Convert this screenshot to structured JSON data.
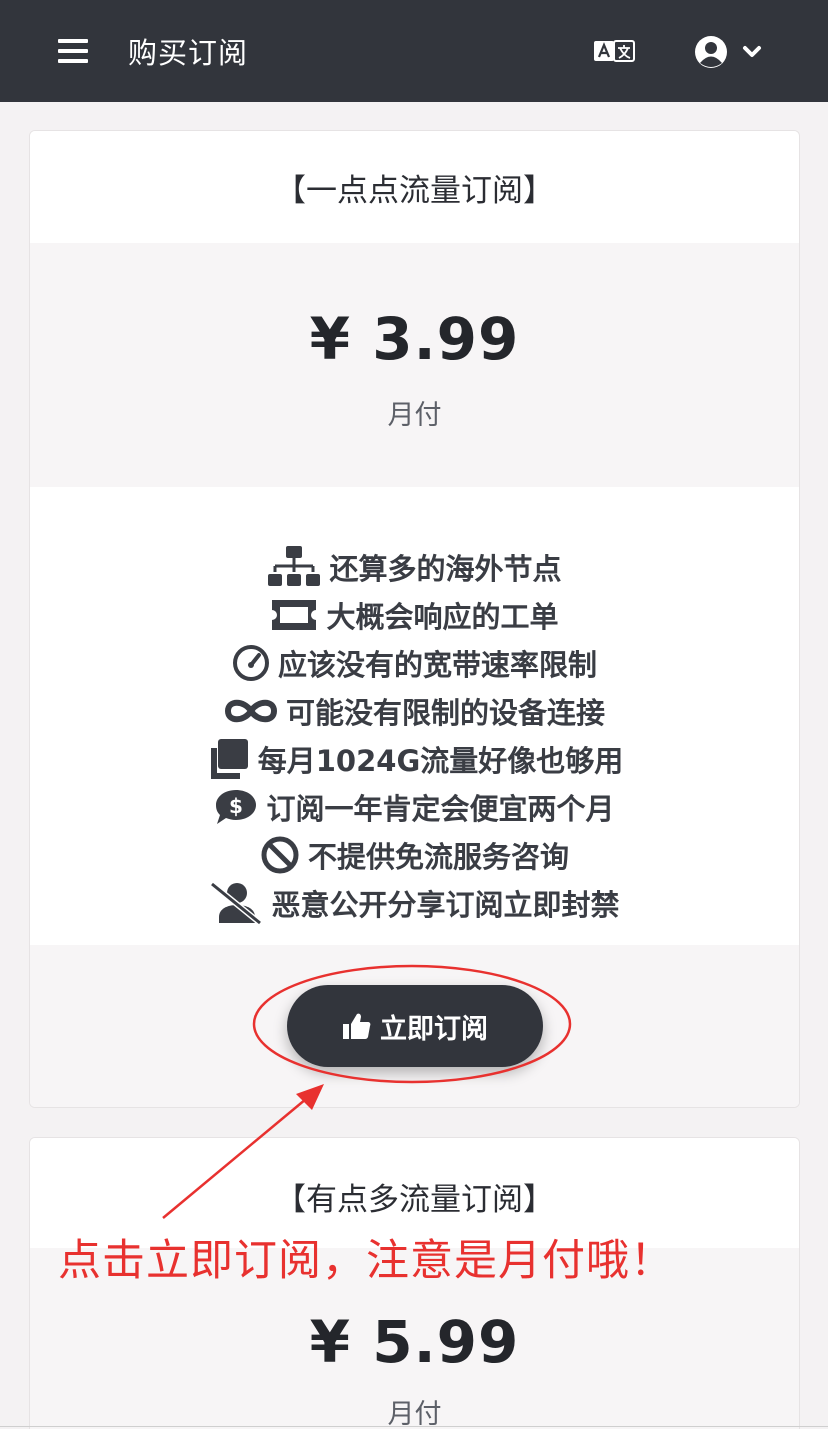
{
  "header": {
    "title": "购买订阅",
    "menu_icon": "hamburger-menu-icon",
    "lang_icon": "translate-icon",
    "user_icon": "user-circle-icon",
    "dropdown_icon": "chevron-down-icon"
  },
  "plans": [
    {
      "name": "【一点点流量订阅】",
      "price": "¥ 3.99",
      "period": "月付",
      "features": [
        {
          "icon": "sitemap-icon",
          "text": "还算多的海外节点"
        },
        {
          "icon": "ticket-icon",
          "text": "大概会响应的工单"
        },
        {
          "icon": "speedometer-icon",
          "text": "应该没有的宽带速率限制"
        },
        {
          "icon": "infinity-icon",
          "text": "可能没有限制的设备连接"
        },
        {
          "icon": "copy-icon",
          "text": "每月1024G流量好像也够用"
        },
        {
          "icon": "dollar-comment-icon",
          "text": "订阅一年肯定会便宜两个月"
        },
        {
          "icon": "ban-icon",
          "text": "不提供免流服务咨询"
        },
        {
          "icon": "user-slash-icon",
          "text": "恶意公开分享订阅立即封禁"
        }
      ],
      "button": {
        "icon": "thumbs-up-icon",
        "label": "立即订阅"
      }
    },
    {
      "name": "【有点多流量订阅】",
      "price": "¥ 5.99",
      "period": "月付"
    }
  ],
  "annotation": {
    "text": "点击立即订阅，注意是月付哦！",
    "color": "#e8312f"
  },
  "colors": {
    "header_bg": "#32353c",
    "button_bg": "#32353c",
    "page_bg": "#f4f2f3"
  }
}
